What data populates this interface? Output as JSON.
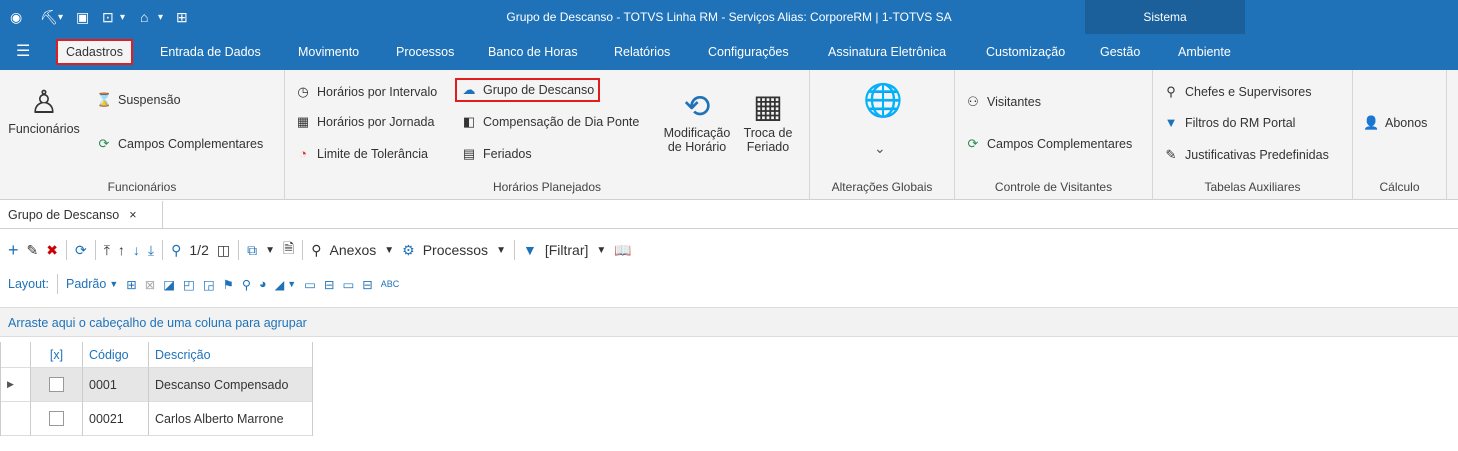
{
  "quickaccess": {
    "icons": [
      "circle-menu-icon",
      "org-chart-icon",
      "dropdown-icon",
      "screen-icon",
      "refresh-screen-icon",
      "dropdown-icon",
      "home-icon",
      "dropdown-icon",
      "grid-icon"
    ]
  },
  "title": "Grupo de Descanso - TOTVS Linha RM - Serviços  Alias: CorporeRM | 1-TOTVS SA",
  "sistema": "Sistema",
  "menu": [
    "Cadastros",
    "Entrada de Dados",
    "Movimento",
    "Processos",
    "Banco de Horas",
    "Relatórios",
    "Configurações",
    "Assinatura Eletrônica",
    "Customização",
    "Gestão",
    "Ambiente"
  ],
  "ribbon": {
    "funcionarios": {
      "big": "Funcionários",
      "items": [
        "Suspensão",
        "Campos Complementares"
      ],
      "label": "Funcionários"
    },
    "horarios": {
      "col1": [
        "Horários por Intervalo",
        "Horários por Jornada",
        "Limite de Tolerância"
      ],
      "col2": [
        "Grupo de Descanso",
        "Compensação de Dia Ponte",
        "Feriados"
      ],
      "big1": "Modificação de Horário",
      "big2": "Troca de Feriado",
      "label": "Horários Planejados"
    },
    "alteracoes": {
      "label": "Alterações Globais",
      "arrow": "⌄"
    },
    "visitantes": {
      "items": [
        "Visitantes",
        "Campos Complementares"
      ],
      "label": "Controle de Visitantes"
    },
    "auxiliares": {
      "items": [
        "Chefes e Supervisores",
        "Filtros do RM Portal",
        "Justificativas Predefinidas"
      ],
      "label": "Tabelas Auxiliares"
    },
    "calculo": {
      "items": [
        "Abonos"
      ],
      "label": "Cálculo"
    }
  },
  "doctab": {
    "label": "Grupo de Descanso",
    "close": "×"
  },
  "toolbar": {
    "page": "1/2",
    "anexos": "Anexos",
    "processos": "Processos",
    "filtrar": "[Filtrar]"
  },
  "layout": {
    "label": "Layout:",
    "value": "Padrão"
  },
  "groupbar": "Arraste aqui o cabeçalho de uma coluna para agrupar",
  "grid": {
    "headers": [
      "[x]",
      "Código",
      "Descrição"
    ],
    "rows": [
      {
        "code": "0001",
        "desc": "Descanso Compensado"
      },
      {
        "code": "00021",
        "desc": "Carlos Alberto Marrone"
      }
    ]
  }
}
